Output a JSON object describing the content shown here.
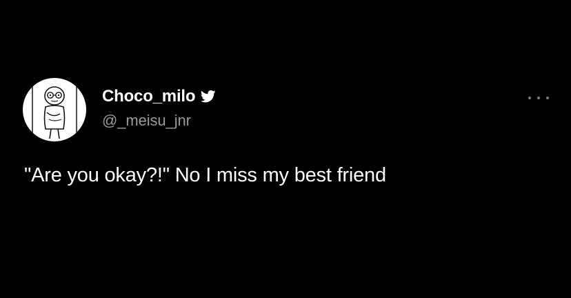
{
  "tweet": {
    "author": {
      "display_name": "Choco_milo",
      "handle": "@_meisu_jnr",
      "verified_icon": "twitter-bird-icon",
      "avatar_icon": "cartoon-character-avatar"
    },
    "more_icon": "ellipsis-icon",
    "text": "\"Are you okay?!\" No I miss my best friend"
  },
  "colors": {
    "background": "#000000",
    "text": "#ffffff",
    "handle": "#9a9a9a",
    "verified": "#ffffff"
  }
}
